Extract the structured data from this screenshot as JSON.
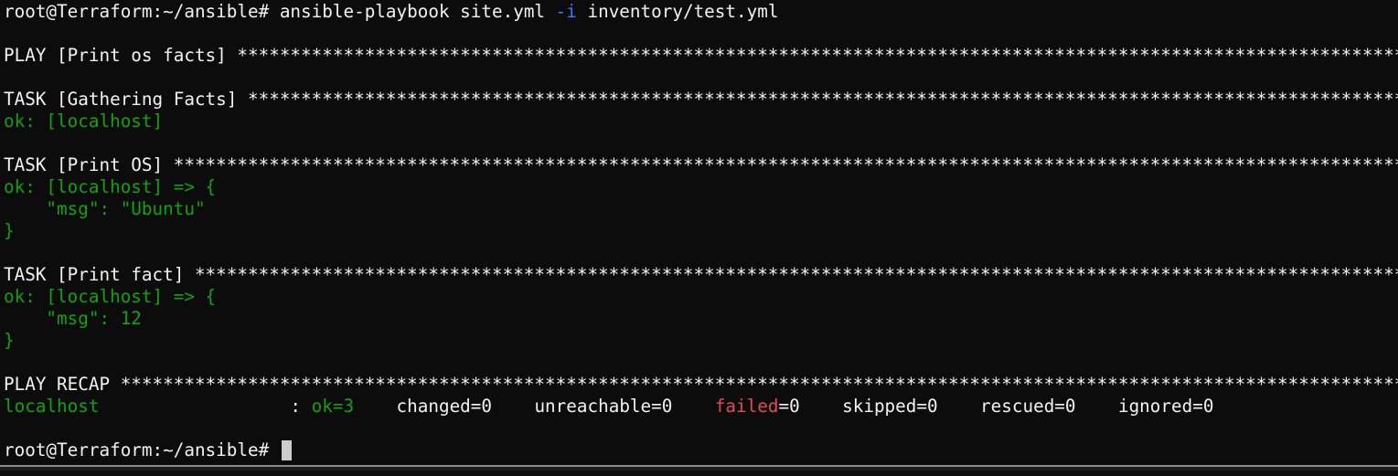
{
  "prompt": "root@Terraform:~/ansible#",
  "command": {
    "program": "ansible-playbook",
    "file": "site.yml",
    "flag": "-i",
    "inventory": "inventory/test.yml"
  },
  "play_header": "PLAY [Print os facts] ",
  "tasks": [
    {
      "header": "TASK [Gathering Facts] ",
      "result": "ok: [localhost]"
    },
    {
      "header": "TASK [Print OS] ",
      "result": "ok: [localhost] => {",
      "msg_line": "    \"msg\": \"Ubuntu\"",
      "close": "}"
    },
    {
      "header": "TASK [Print fact] ",
      "result": "ok: [localhost] => {",
      "msg_line": "    \"msg\": 12",
      "close": "}"
    }
  ],
  "recap": {
    "header": "PLAY RECAP ",
    "host": "localhost",
    "sep": "                  : ",
    "ok": "ok=3",
    "changed": "changed=0",
    "unreachable": "unreachable=0",
    "failed_label": "failed",
    "failed_value": "=0",
    "skipped": "skipped=0",
    "rescued": "rescued=0",
    "ignored": "ignored=0"
  },
  "stars": "******************************************************************************************************************************************************",
  "final_prompt": "root@Terraform:~/ansible# ",
  "colors": {
    "background": "#0c0c0c",
    "text": "#f2f2f2",
    "ok_green": "#13a10e",
    "flag_blue": "#3b78ff",
    "failed_red": "#e74856",
    "cursor": "#cccccc"
  }
}
